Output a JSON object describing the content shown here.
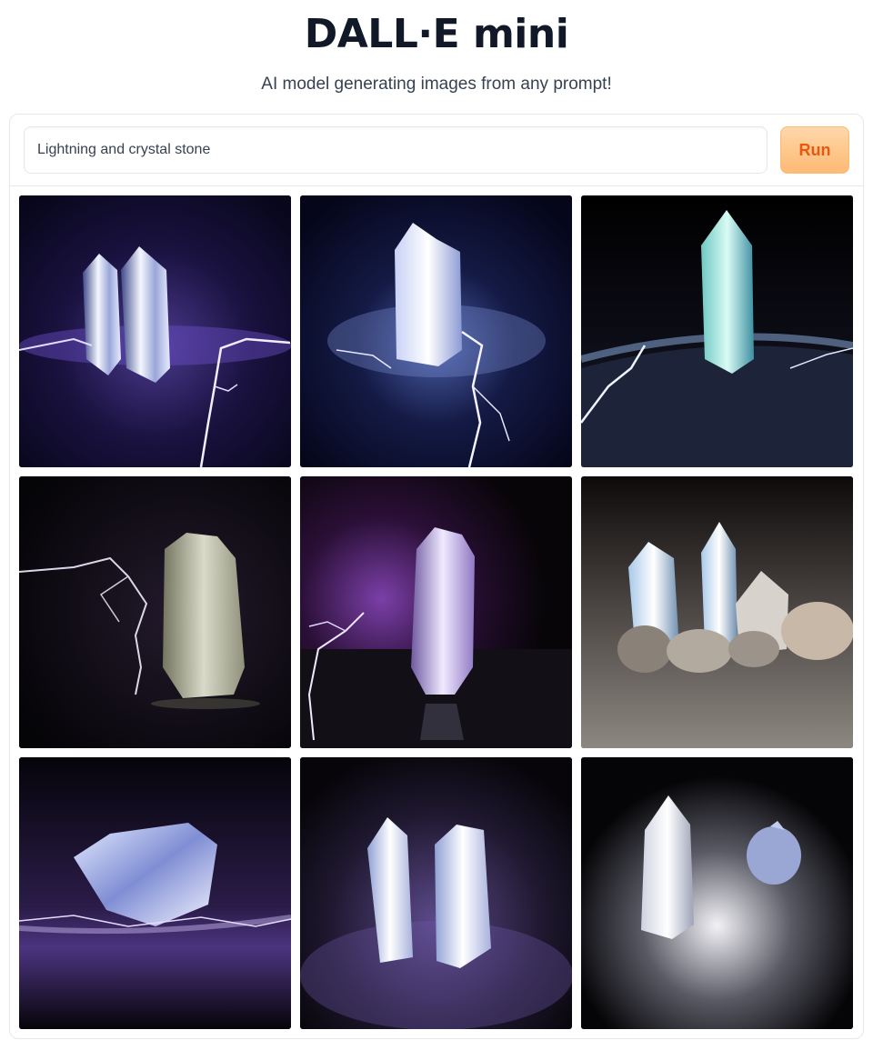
{
  "header": {
    "title": "DALL·E mini",
    "subtitle": "AI model generating images from any prompt!"
  },
  "prompt": {
    "value": "Lightning and crystal stone",
    "run_label": "Run"
  },
  "colors": {
    "accent": "#ea580c",
    "button_bg": "#fdba74",
    "border": "#e5e7eb"
  },
  "gallery": {
    "images": [
      {
        "subject": "twin-crystal-lightning-violet"
      },
      {
        "subject": "single-crystal-lightning-blue"
      },
      {
        "subject": "aqua-crystal-on-dark-moss"
      },
      {
        "subject": "crystal-with-side-lightning"
      },
      {
        "subject": "violet-crystal-lightning-reflection"
      },
      {
        "subject": "crystal-cluster-on-sand"
      },
      {
        "subject": "broken-crystal-violet-glow"
      },
      {
        "subject": "two-crystals-violet-dust"
      },
      {
        "subject": "crystal-and-small-stone"
      }
    ]
  }
}
